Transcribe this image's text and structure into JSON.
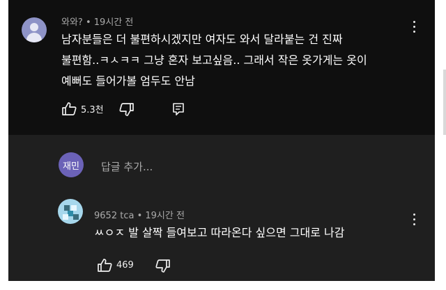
{
  "main_comment": {
    "username": "와와?",
    "separator": "•",
    "time": "19시간 전",
    "lines": [
      "남자분들은 더 불편하시겠지만 여자도 와서 달라붙는 건 진짜",
      "불편함..ㅋㅅㅋㅋ 그냥 혼자 보고싶음.. 그래서 작은 옷가게는 옷이",
      "예뻐도 들어가볼 엄두도 안남"
    ],
    "like_count": "5.3천"
  },
  "reply_box": {
    "avatar_text": "재민",
    "placeholder": "답글 추가..."
  },
  "reply_comment": {
    "username": "9652 tca",
    "separator": "•",
    "time": "19시간 전",
    "text": "ㅆㅇㅈ 발 살짝 들여보고 따라온다 싶으면 그대로 나감",
    "like_count": "469"
  },
  "colors": {
    "background_top": "#0f0f0f",
    "background_bottom": "#1f1f1f",
    "text_primary": "#ffffff",
    "text_secondary": "#aaaaaa",
    "avatar_main": "#8e93c7",
    "avatar_reply_input": "#6b62b7"
  },
  "icons": {
    "like": "thumbs-up-icon",
    "dislike": "thumbs-down-icon",
    "reply": "reply-icon",
    "menu": "more-vertical-icon"
  }
}
